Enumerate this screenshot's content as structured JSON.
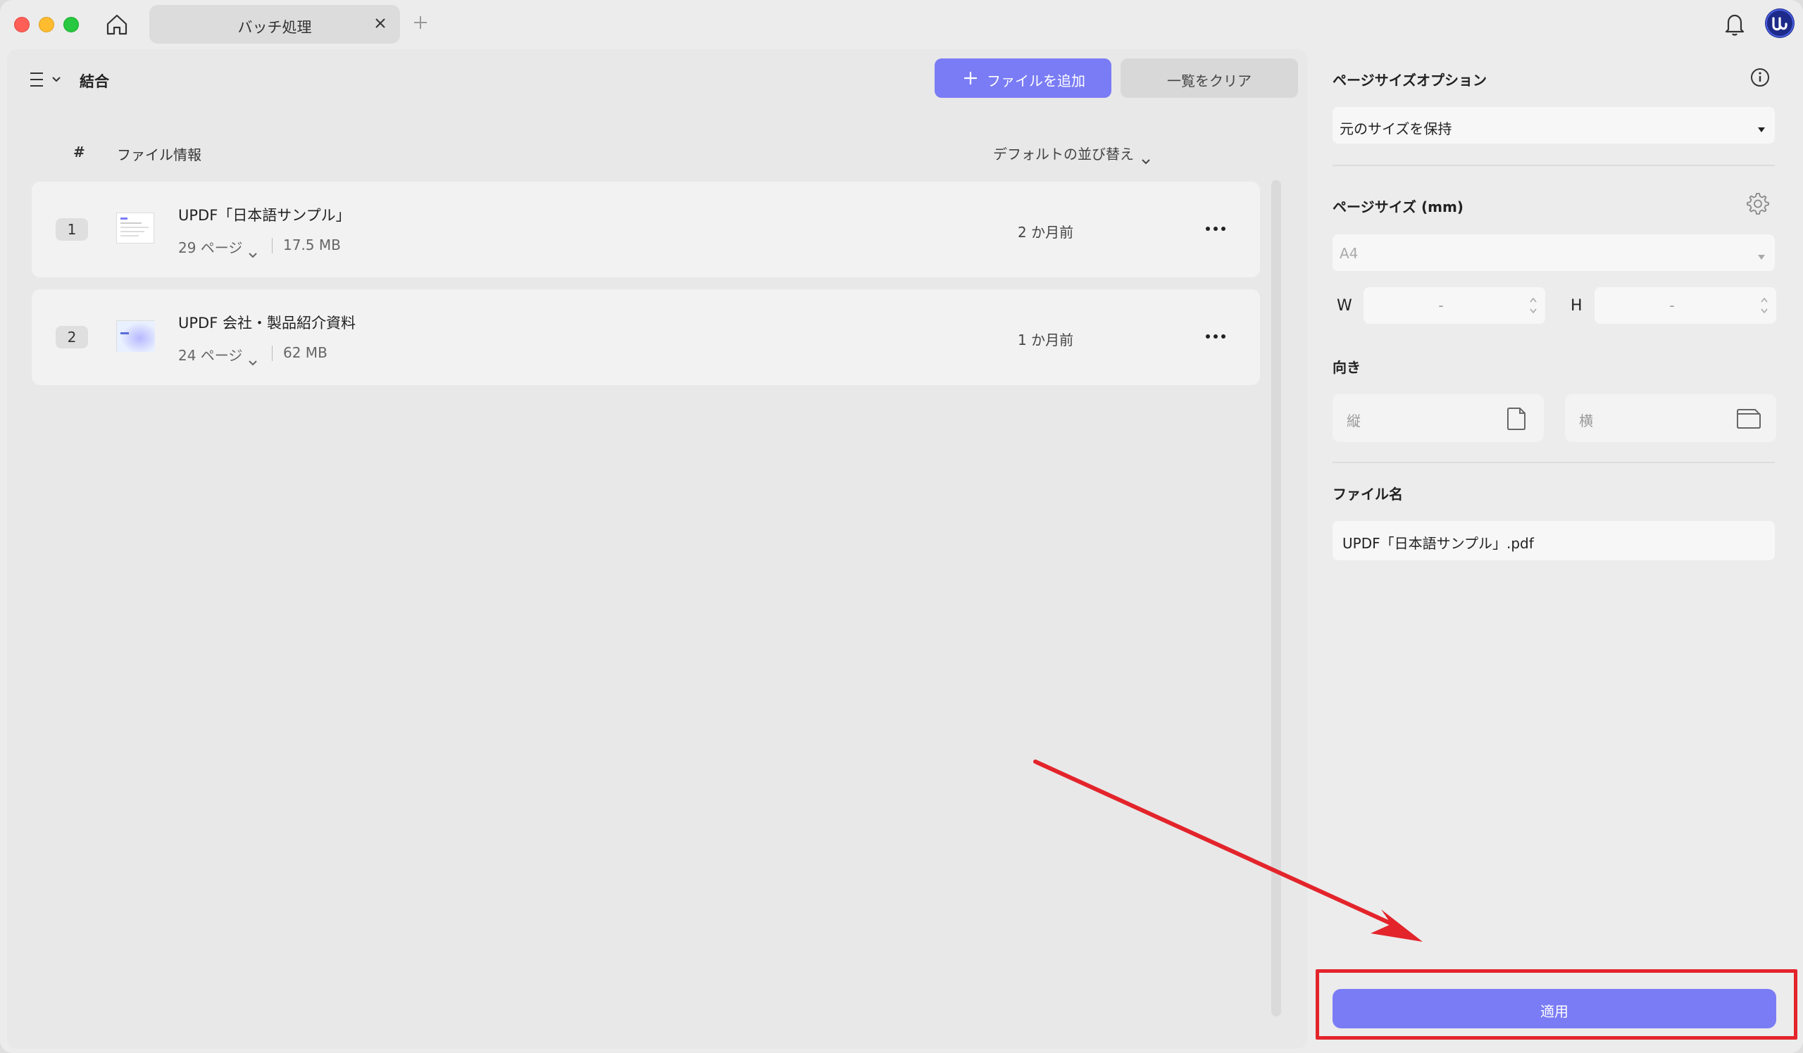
{
  "titlebar": {
    "tab_label": "バッチ処理"
  },
  "toolbar": {
    "mode_label": "結合",
    "add_file_label": "ファイルを追加",
    "clear_list_label": "一覧をクリア"
  },
  "list": {
    "col_hash": "#",
    "col_info": "ファイル情報",
    "sort_label": "デフォルトの並び替え",
    "files": [
      {
        "num": "1",
        "name": "UPDF「日本語サンプル」",
        "pages": "29 ページ",
        "size": "17.5 MB",
        "date": "2 か月前"
      },
      {
        "num": "2",
        "name": "UPDF 会社・製品紹介資料",
        "pages": "24 ページ",
        "size": "62 MB",
        "date": "1 か月前"
      }
    ]
  },
  "options": {
    "page_size_option_label": "ページサイズオプション",
    "page_size_option_value": "元のサイズを保持",
    "page_size_label": "ページサイズ (mm)",
    "page_size_value": "A4",
    "width_letter": "W",
    "width_value": "-",
    "height_letter": "H",
    "height_value": "-",
    "orientation_label": "向き",
    "portrait_label": "縦",
    "landscape_label": "横",
    "filename_label": "ファイル名",
    "filename_value": "UPDF「日本語サンプル」.pdf",
    "apply_label": "適用"
  },
  "colors": {
    "accent": "#7a7cf5",
    "annotation": "#e3242b"
  }
}
